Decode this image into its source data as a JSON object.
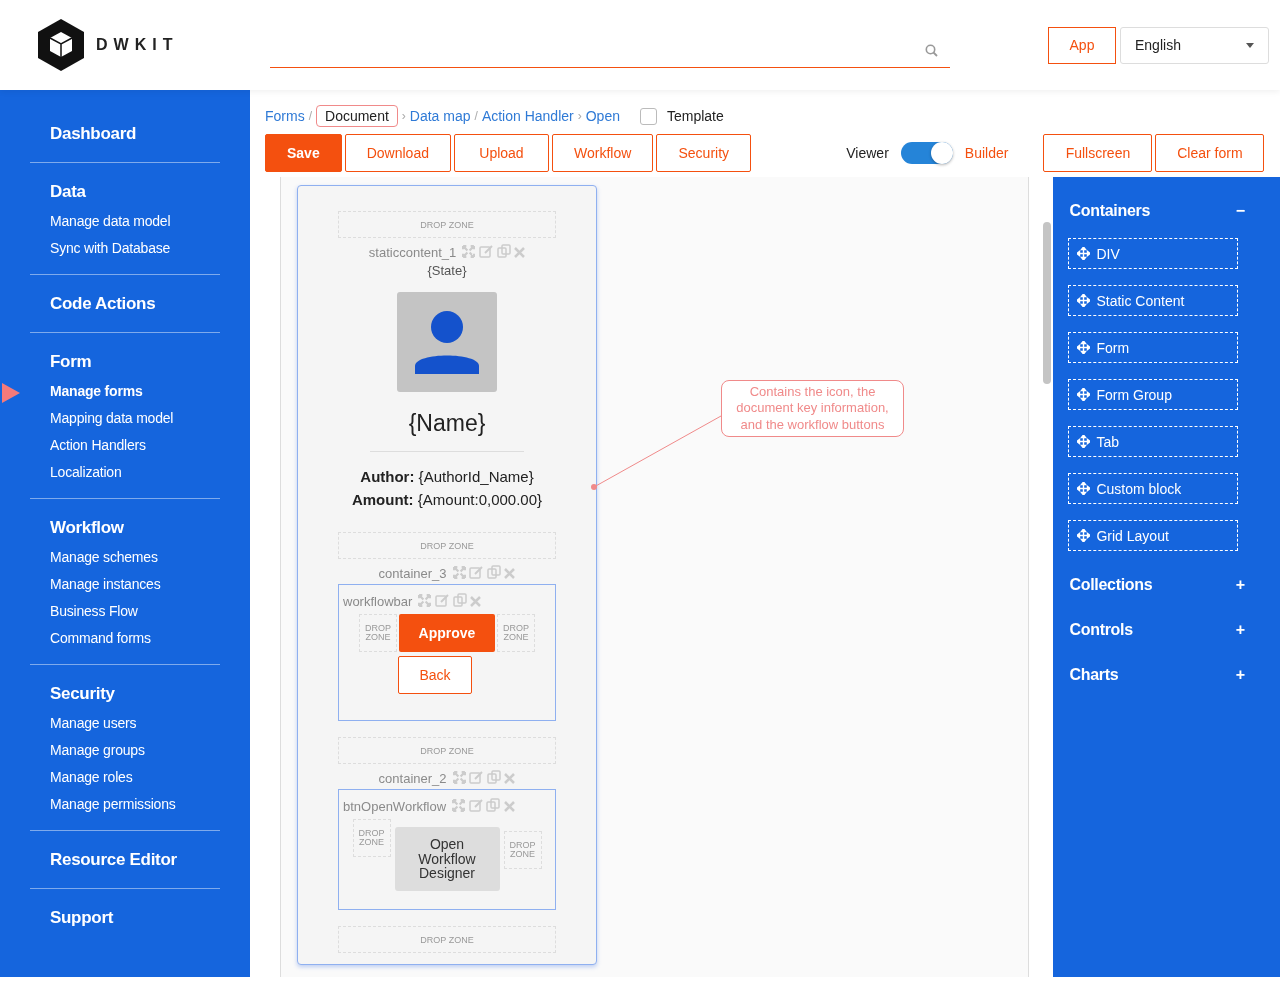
{
  "logo": {
    "text": "DWKIT"
  },
  "header": {
    "app_button": "App",
    "language": "English"
  },
  "sidebar": {
    "sections": [
      {
        "title": "Dashboard"
      },
      {
        "title": "Data",
        "items": [
          {
            "label": "Manage data model",
            "selected": false
          },
          {
            "label": "Sync with Database",
            "selected": false
          }
        ]
      },
      {
        "title": "Code Actions"
      },
      {
        "title": "Form",
        "items": [
          {
            "label": "Manage forms",
            "selected": true
          },
          {
            "label": "Mapping data model",
            "selected": false
          },
          {
            "label": "Action Handlers",
            "selected": false
          },
          {
            "label": "Localization",
            "selected": false
          }
        ]
      },
      {
        "title": "Workflow",
        "items": [
          {
            "label": "Manage schemes",
            "selected": false
          },
          {
            "label": "Manage instances",
            "selected": false
          },
          {
            "label": "Business Flow",
            "selected": false
          },
          {
            "label": "Command forms",
            "selected": false
          }
        ]
      },
      {
        "title": "Security",
        "items": [
          {
            "label": "Manage users",
            "selected": false
          },
          {
            "label": "Manage groups",
            "selected": false
          },
          {
            "label": "Manage roles",
            "selected": false
          },
          {
            "label": "Manage permissions",
            "selected": false
          }
        ]
      },
      {
        "title": "Resource Editor"
      },
      {
        "title": "Support"
      }
    ]
  },
  "breadcrumb": [
    {
      "label": "Forms",
      "selected": false,
      "sep": "/"
    },
    {
      "label": "Document",
      "selected": true,
      "sep": "›"
    },
    {
      "label": "Data map",
      "selected": false,
      "sep": "/"
    },
    {
      "label": "Action Handler",
      "selected": false,
      "sep": "›"
    },
    {
      "label": "Open",
      "selected": false
    }
  ],
  "template": {
    "label": "Template",
    "checked": false
  },
  "toolbar": [
    {
      "label": "Save",
      "kind": "primary"
    },
    {
      "label": "Download",
      "kind": "outline"
    },
    {
      "label": "Upload",
      "kind": "outline"
    },
    {
      "label": "Workflow",
      "kind": "outline"
    },
    {
      "label": "Security",
      "kind": "outline"
    }
  ],
  "mode": {
    "left": "Viewer",
    "right": "Builder",
    "on": true
  },
  "right_buttons": [
    "Fullscreen",
    "Clear form"
  ],
  "form": {
    "drop_zones": [
      "DROP ZONE",
      "DROP ZONE",
      "DROP ZONE",
      "DROP ZONE"
    ],
    "static_label": "staticcontent_1",
    "state": "{State}",
    "name": "{Name}",
    "fields": [
      "**Author:** {AuthorId_Name}",
      "**Amount:** {Amount:0,000.00}"
    ],
    "container_3_label": "container_3",
    "workflowbar": {
      "label": "workflowbar",
      "left_zone": "DROP ZONE",
      "right_zone": "DROP ZONE",
      "approve": "Approve",
      "back": "Back"
    },
    "container_2_label": "container_2",
    "open_workflow": {
      "label": "btnOpenWorkflow",
      "left_zone": "DROP ZONE",
      "right_zone": "DROP ZONE",
      "button": "Open Workflow Designer"
    }
  },
  "annotation": {
    "text": "Contains the icon, the document key information, and the workflow buttons"
  },
  "palette": {
    "sections": [
      {
        "title": "Containers",
        "toggle": "−",
        "items": [
          "DIV",
          "Static Content",
          "Form",
          "Form Group",
          "Tab",
          "Custom block",
          "Grid Layout"
        ]
      },
      {
        "title": "Collections",
        "toggle": "+"
      },
      {
        "title": "Controls",
        "toggle": "+"
      },
      {
        "title": "Charts",
        "toggle": "+"
      }
    ]
  }
}
